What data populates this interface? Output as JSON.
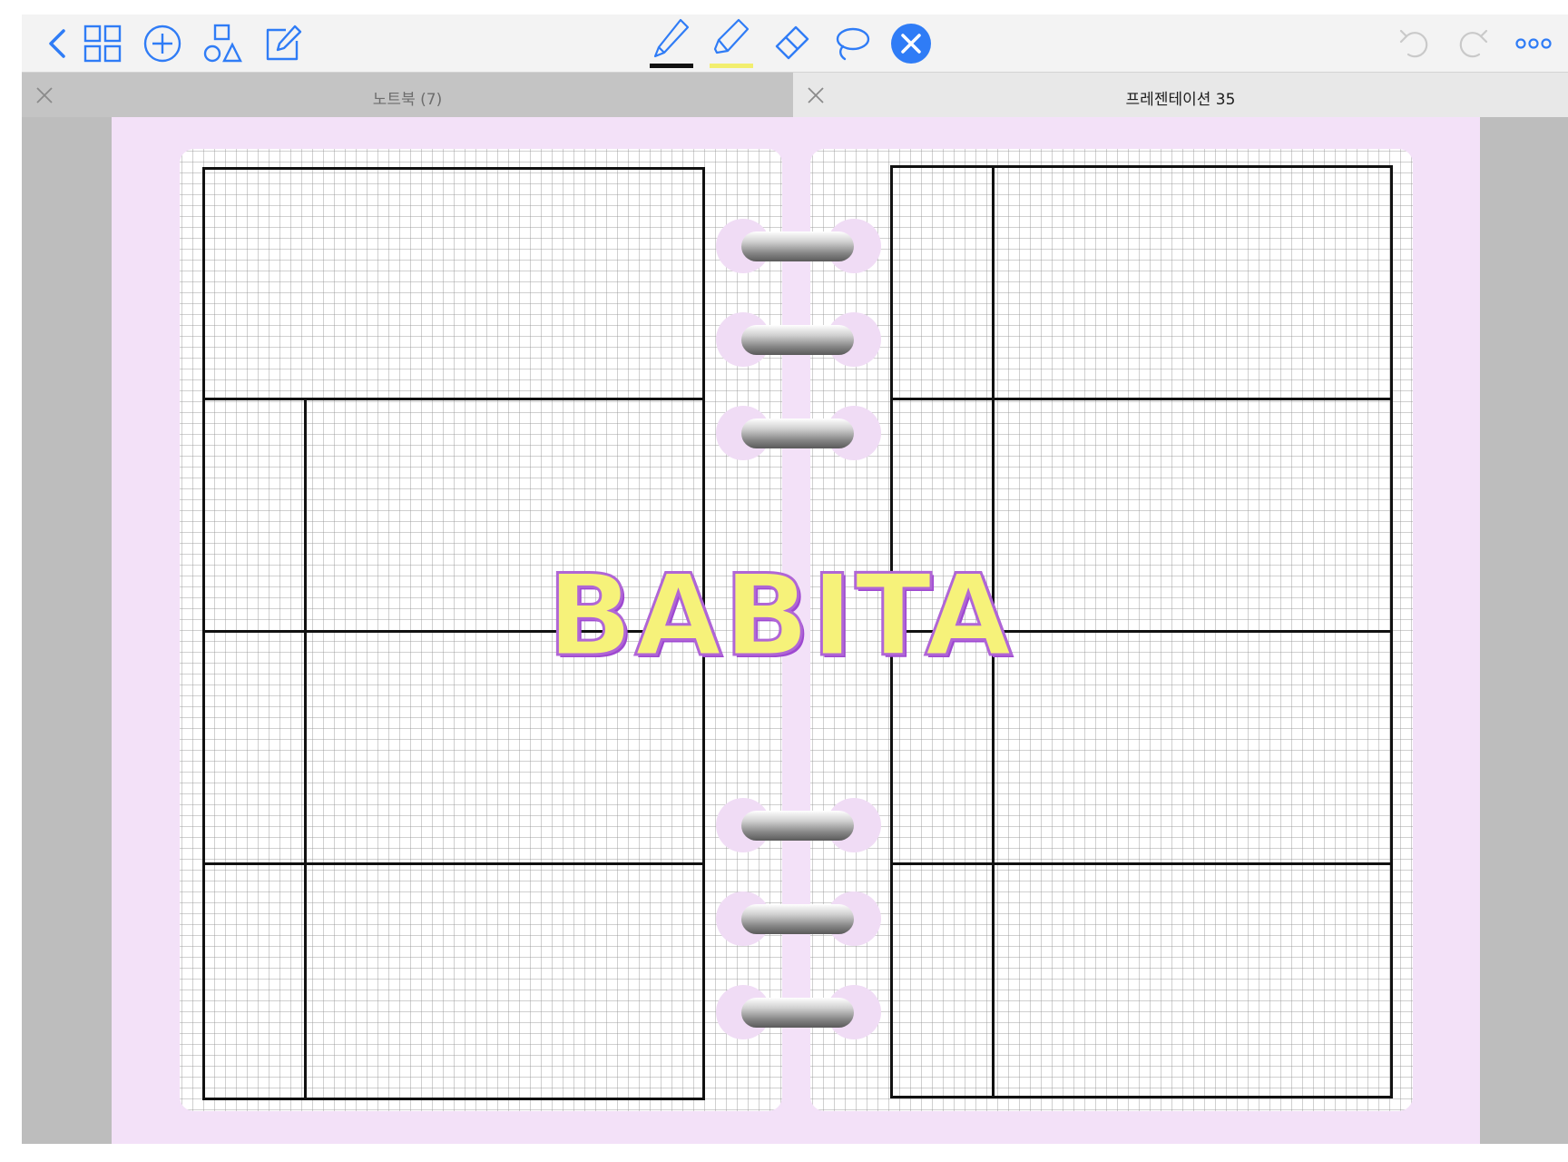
{
  "toolbar": {
    "icons": {
      "back": "chevron-left-icon",
      "thumbnails": "grid-icon",
      "add": "plus-circle-icon",
      "shapes": "shapes-icon",
      "edit": "compose-icon",
      "pen": "pen-icon",
      "highlighter": "highlighter-icon",
      "eraser": "eraser-icon",
      "lasso": "lasso-icon",
      "active_tool": "close-circle-icon",
      "undo": "undo-icon",
      "redo": "redo-icon",
      "more": "more-icon"
    },
    "pen_color": "#111111",
    "highlighter_color": "#f2ee6e",
    "accent_color": "#2f7cf6"
  },
  "tabs": [
    {
      "title": "노트북 (7)",
      "active": false
    },
    {
      "title": "프레젠테이션 35",
      "active": true
    }
  ],
  "page": {
    "background_color": "#f3e1f8",
    "title": "BABITA"
  }
}
